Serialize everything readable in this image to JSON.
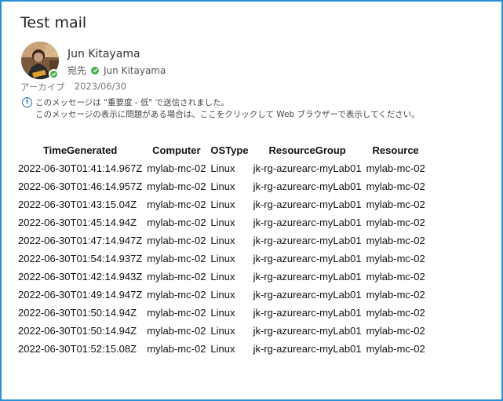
{
  "message": {
    "subject": "Test mail",
    "sender_name": "Jun Kitayama",
    "to_label": "宛先",
    "to_name": "Jun Kitayama",
    "folder": "アーカイブ",
    "date": "2023/06/30",
    "info_line1": "このメッセージは \"重要度 - 低\" で送信されました。",
    "info_line2": "このメッセージの表示に問題がある場合は、ここをクリックして Web ブラウザーで表示してください。"
  },
  "table": {
    "headers": [
      "TimeGenerated",
      "Computer",
      "OSType",
      "ResourceGroup",
      "Resource"
    ],
    "rows": [
      [
        "2022-06-30T01:41:14.967Z",
        "mylab-mc-02",
        "Linux",
        "jk-rg-azurearc-myLab01",
        "mylab-mc-02"
      ],
      [
        "2022-06-30T01:46:14.957Z",
        "mylab-mc-02",
        "Linux",
        "jk-rg-azurearc-myLab01",
        "mylab-mc-02"
      ],
      [
        "2022-06-30T01:43:15.04Z",
        "mylab-mc-02",
        "Linux",
        "jk-rg-azurearc-myLab01",
        "mylab-mc-02"
      ],
      [
        "2022-06-30T01:45:14.94Z",
        "mylab-mc-02",
        "Linux",
        "jk-rg-azurearc-myLab01",
        "mylab-mc-02"
      ],
      [
        "2022-06-30T01:47:14.947Z",
        "mylab-mc-02",
        "Linux",
        "jk-rg-azurearc-myLab01",
        "mylab-mc-02"
      ],
      [
        "2022-06-30T01:54:14.937Z",
        "mylab-mc-02",
        "Linux",
        "jk-rg-azurearc-myLab01",
        "mylab-mc-02"
      ],
      [
        "2022-06-30T01:42:14.943Z",
        "mylab-mc-02",
        "Linux",
        "jk-rg-azurearc-myLab01",
        "mylab-mc-02"
      ],
      [
        "2022-06-30T01:49:14.947Z",
        "mylab-mc-02",
        "Linux",
        "jk-rg-azurearc-myLab01",
        "mylab-mc-02"
      ],
      [
        "2022-06-30T01:50:14.94Z",
        "mylab-mc-02",
        "Linux",
        "jk-rg-azurearc-myLab01",
        "mylab-mc-02"
      ],
      [
        "2022-06-30T01:50:14.94Z",
        "mylab-mc-02",
        "Linux",
        "jk-rg-azurearc-myLab01",
        "mylab-mc-02"
      ],
      [
        "2022-06-30T01:52:15.08Z",
        "mylab-mc-02",
        "Linux",
        "jk-rg-azurearc-myLab01",
        "mylab-mc-02"
      ]
    ]
  },
  "icons": {
    "avatar": "sender-avatar-photo",
    "presence": "presence-available-icon",
    "recipient_status": "check-circle-icon",
    "info": "info-icon"
  },
  "colors": {
    "frame_border": "#2b8fd6",
    "presence_green": "#4caf50",
    "info_blue": "#2b6cb0"
  }
}
